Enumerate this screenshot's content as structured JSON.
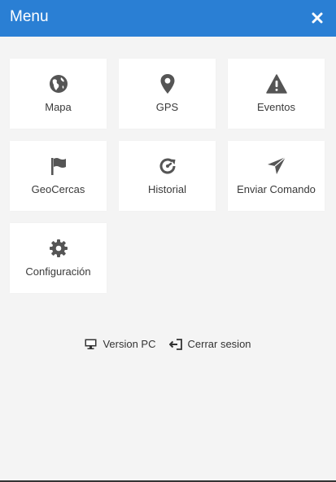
{
  "header": {
    "title": "Menu",
    "background_color": "#2a7fd4",
    "close_icon": "close-icon"
  },
  "menu": {
    "items": [
      {
        "label": "Mapa",
        "icon": "globe-icon"
      },
      {
        "label": "GPS",
        "icon": "map-marker-icon"
      },
      {
        "label": "Eventos",
        "icon": "warning-icon"
      },
      {
        "label": "GeoCercas",
        "icon": "flag-icon"
      },
      {
        "label": "Historial",
        "icon": "history-icon"
      },
      {
        "label": "Enviar Comando",
        "icon": "send-icon"
      },
      {
        "label": "Configuración",
        "icon": "gear-icon"
      }
    ]
  },
  "footer": {
    "version_pc": {
      "label": "Version PC",
      "icon": "monitor-icon"
    },
    "logout": {
      "label": "Cerrar sesion",
      "icon": "sign-out-icon"
    }
  }
}
